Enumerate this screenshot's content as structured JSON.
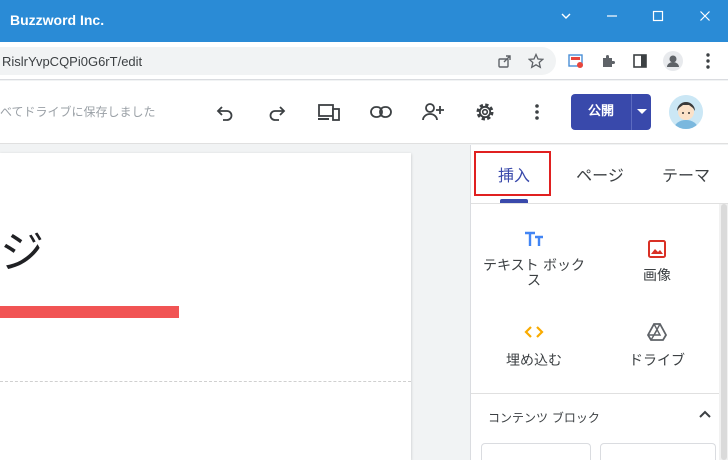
{
  "window": {
    "title": "Buzzword Inc."
  },
  "address_bar": {
    "url": "RislrYvpCQPi0G6rT/edit"
  },
  "toolbar": {
    "save_status": "べてドライブに保存しました",
    "publish_label": "公開"
  },
  "canvas": {
    "page_title": "ジ"
  },
  "panel": {
    "tabs": [
      {
        "label": "挿入"
      },
      {
        "label": "ページ"
      },
      {
        "label": "テーマ"
      }
    ],
    "insert_items": [
      {
        "label": "テキスト ボックス"
      },
      {
        "label": "画像"
      },
      {
        "label": "埋め込む"
      },
      {
        "label": "ドライブ"
      }
    ],
    "section": {
      "title": "コンテンツ ブロック"
    }
  },
  "colors": {
    "titlebar": "#2a8bd6",
    "accent": "#3949ab",
    "red_bar": "#f15454",
    "highlight_box": "#e02020"
  }
}
